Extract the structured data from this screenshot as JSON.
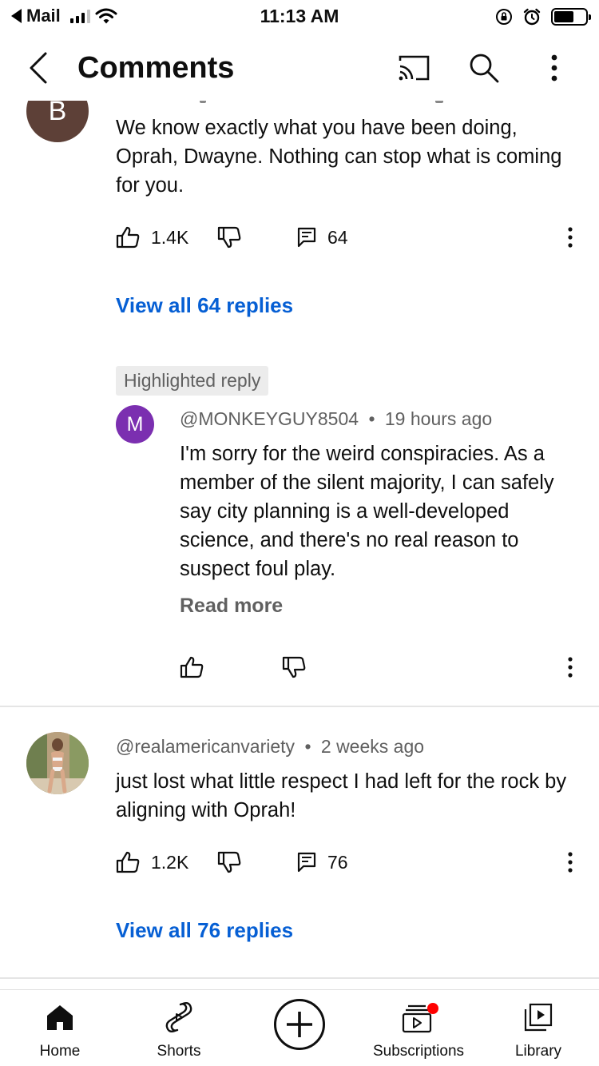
{
  "status_bar": {
    "back_app": "Mail",
    "time": "11:13 AM"
  },
  "header": {
    "title": "Comments"
  },
  "comments": [
    {
      "avatar_letter": "B",
      "avatar_color": "#5d4037",
      "text": "We know exactly what you have been doing, Oprah, Dwayne. Nothing can stop what is coming for you.",
      "likes": "1.4K",
      "reply_count": "64",
      "view_replies": "View all 64 replies",
      "highlighted_reply": {
        "chip": "Highlighted reply",
        "avatar_letter": "M",
        "avatar_color": "#7b2fb0",
        "author": "@MONKEYGUY8504",
        "time": "19 hours ago",
        "text": "I'm sorry for the weird conspiracies. As a member of the silent majority, I can safely say city planning is a well-developed science, and there's no real reason to suspect foul play.",
        "read_more": "Read more"
      }
    },
    {
      "author": "@realamericanvariety",
      "time": "2 weeks ago",
      "text": "just lost what little respect I had left for the rock by aligning with Oprah!",
      "likes": "1.2K",
      "reply_count": "76",
      "view_replies": "View all 76 replies"
    }
  ],
  "meta_separator": "•",
  "bottom_nav": {
    "home": "Home",
    "shorts": "Shorts",
    "subscriptions": "Subscriptions",
    "library": "Library"
  },
  "colors": {
    "link_blue": "#065fd4",
    "secondary_text": "#606060",
    "notification_dot": "#ff0000"
  }
}
